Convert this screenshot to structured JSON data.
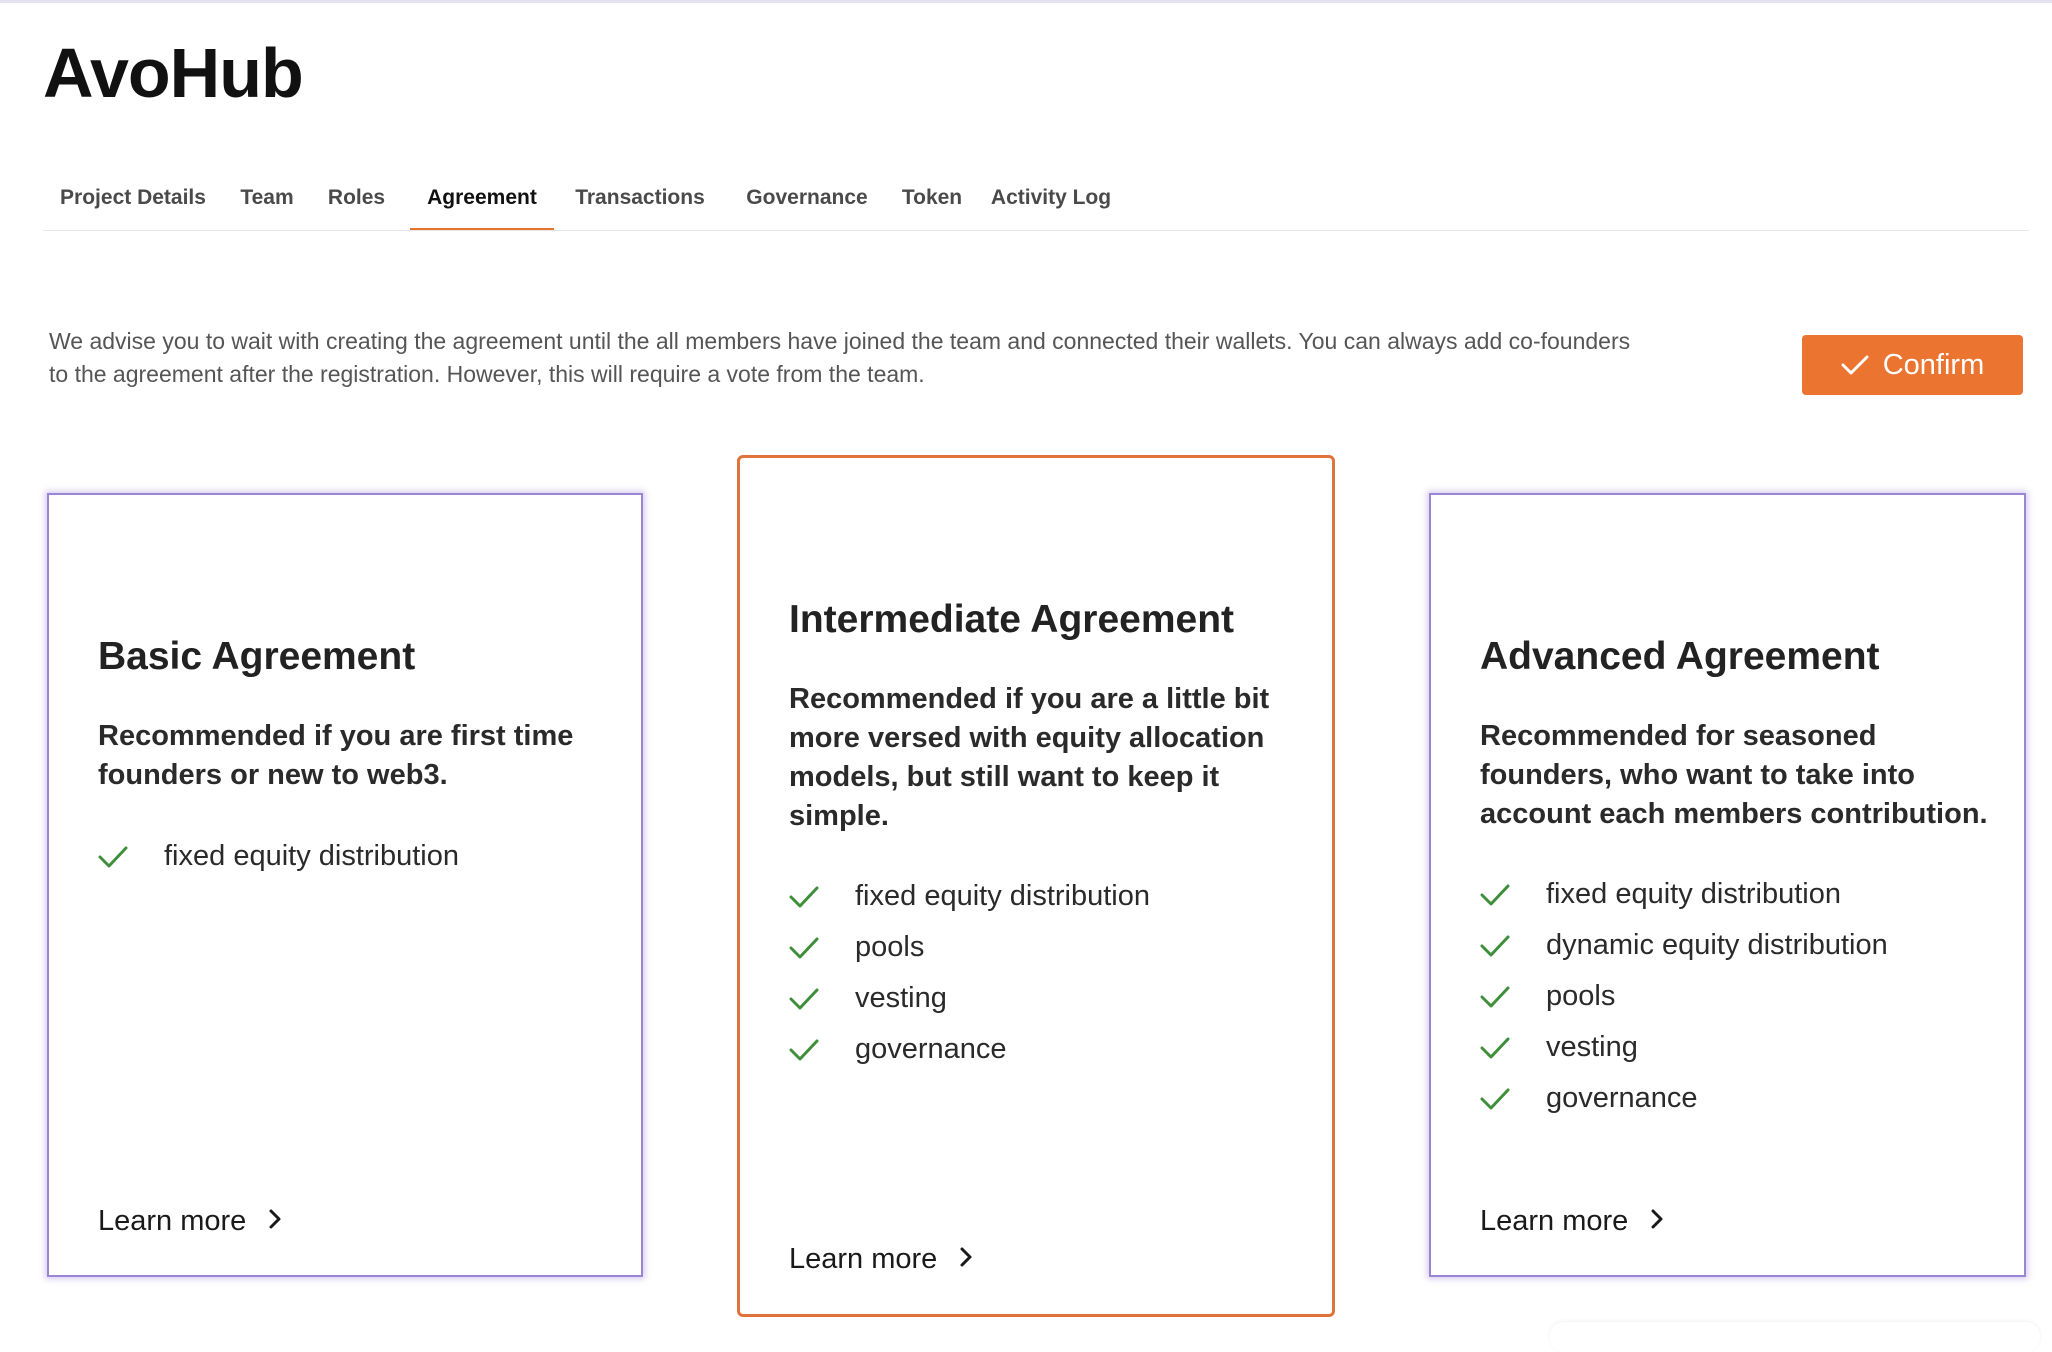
{
  "app": {
    "title": "AvoHub"
  },
  "tabs": [
    {
      "label": "Project Details"
    },
    {
      "label": "Team"
    },
    {
      "label": "Roles"
    },
    {
      "label": "Agreement",
      "active": true
    },
    {
      "label": "Transactions"
    },
    {
      "label": "Governance"
    },
    {
      "label": "Token"
    },
    {
      "label": "Activity Log"
    }
  ],
  "advice": {
    "text": "We advise you to wait with creating the agreement until the all members have joined the team and connected their wallets. You can always add co-founders to the agreement after the registration. However, this will require a vote from the team."
  },
  "confirm": {
    "label": "Confirm",
    "icon": "check-icon"
  },
  "colors": {
    "accent": "#ea7430",
    "selected_border": "#e0733b",
    "card_border": "#9a86d4",
    "check": "#3f8f3a"
  },
  "cards": [
    {
      "title": "Basic Agreement",
      "description": "Recommended if you are first time founders or new to web3.",
      "features": [
        "fixed equity distribution"
      ],
      "learn_more": "Learn more",
      "selected": false
    },
    {
      "title": "Intermediate Agreement",
      "description": "Recommended if you are a little bit more versed with equity allocation models, but still want to keep it simple.",
      "features": [
        "fixed equity distribution",
        "pools",
        "vesting",
        "governance"
      ],
      "learn_more": "Learn more",
      "selected": true
    },
    {
      "title": "Advanced Agreement",
      "description": "Recommended for seasoned founders, who want to take into account each members contribution.",
      "features": [
        "fixed equity distribution",
        "dynamic equity distribution",
        "pools",
        "vesting",
        "governance"
      ],
      "learn_more": "Learn more",
      "selected": false
    }
  ]
}
